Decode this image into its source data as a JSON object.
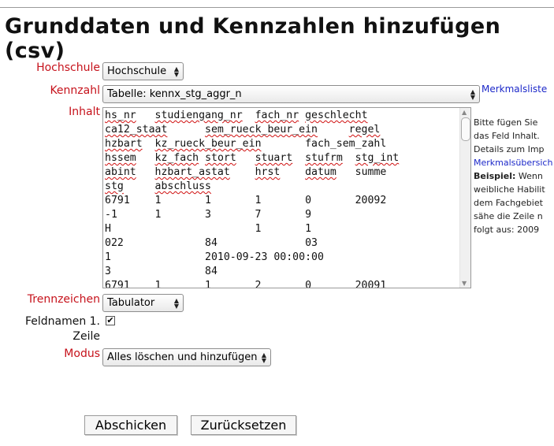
{
  "page": {
    "title": "Grunddaten und Kennzahlen hinzufügen (csv)"
  },
  "form": {
    "hochschule": {
      "label": "Hochschule",
      "value": "Hochschule"
    },
    "kennzahl": {
      "label": "Kennzahl",
      "value": "Tabelle: kennx_stg_aggr_n",
      "link": "Merkmalsliste"
    },
    "inhalt": {
      "label": "Inhalt",
      "rows": [
        [
          {
            "t": "hs_nr",
            "s": true
          },
          {
            "t": "   "
          },
          {
            "t": "studiengang_nr",
            "s": true
          },
          {
            "t": "  "
          },
          {
            "t": "fach_nr",
            "s": true
          },
          {
            "t": " "
          },
          {
            "t": "geschlecht",
            "s": true
          }
        ],
        [
          {
            "t": "ca12_staat",
            "s": true
          },
          {
            "t": "      "
          },
          {
            "t": "sem_rueck_beur_ein",
            "s": true
          },
          {
            "t": "     "
          },
          {
            "t": "regel",
            "s": true
          }
        ],
        [
          {
            "t": "hzbart",
            "s": true
          },
          {
            "t": "  "
          },
          {
            "t": "kz_rueck_beur_ein",
            "s": true
          },
          {
            "t": "       "
          },
          {
            "t": "fach_sem_zahl",
            "s": false
          }
        ],
        [
          {
            "t": "hssem",
            "s": true
          },
          {
            "t": "   "
          },
          {
            "t": "kz_fach",
            "s": true
          },
          {
            "t": " "
          },
          {
            "t": "stort",
            "s": true
          },
          {
            "t": "   "
          },
          {
            "t": "stuart",
            "s": true
          },
          {
            "t": "  "
          },
          {
            "t": "stufrm",
            "s": true
          },
          {
            "t": "  "
          },
          {
            "t": "stg_int",
            "s": true
          }
        ],
        [
          {
            "t": "abint",
            "s": true
          },
          {
            "t": "   "
          },
          {
            "t": "hzbart_astat",
            "s": true
          },
          {
            "t": "    "
          },
          {
            "t": "hrst",
            "s": true
          },
          {
            "t": "    "
          },
          {
            "t": "datum",
            "s": true
          },
          {
            "t": "   "
          },
          {
            "t": "summe",
            "s": false
          }
        ],
        [
          {
            "t": "stg",
            "s": true
          },
          {
            "t": "     "
          },
          {
            "t": "abschluss",
            "s": true
          }
        ],
        [
          {
            "t": "6791    1       1       1       0       20092"
          }
        ],
        [
          {
            "t": "-1      1       3       7       9"
          }
        ],
        [
          {
            "t": "H                       1       1"
          }
        ],
        [
          {
            "t": "022             84              03"
          }
        ],
        [
          {
            "t": "1               2010-09-23 00:00:00"
          }
        ],
        [
          {
            "t": "3               84"
          }
        ],
        [
          {
            "t": "6791    1       1       2       0       20091"
          }
        ]
      ]
    },
    "help": {
      "line1": "Bitte fügen Sie",
      "line2": "das Feld Inhalt.",
      "line3": "Details zum Imp",
      "link": "Merkmalsübersich",
      "example_label": "Beispiel:",
      "example_rest": " Wenn",
      "line6": "weibliche Habilit",
      "line7": "dem Fachgebiet",
      "line8": "sähe die Zeile n",
      "line9": "folgt aus: 2009"
    },
    "trennzeichen": {
      "label": "Trennzeichen",
      "value": "Tabulator"
    },
    "feldnamen": {
      "label_line1": "Feldnamen 1.",
      "label_line2": "Zeile",
      "checked": "✔"
    },
    "modus": {
      "label": "Modus",
      "value": "Alles löschen und hinzufügen"
    }
  },
  "buttons": {
    "submit": "Abschicken",
    "reset": "Zurücksetzen"
  },
  "icons": {
    "select_arrows": "updown-arrows-icon",
    "scroll": "scrollbar"
  }
}
